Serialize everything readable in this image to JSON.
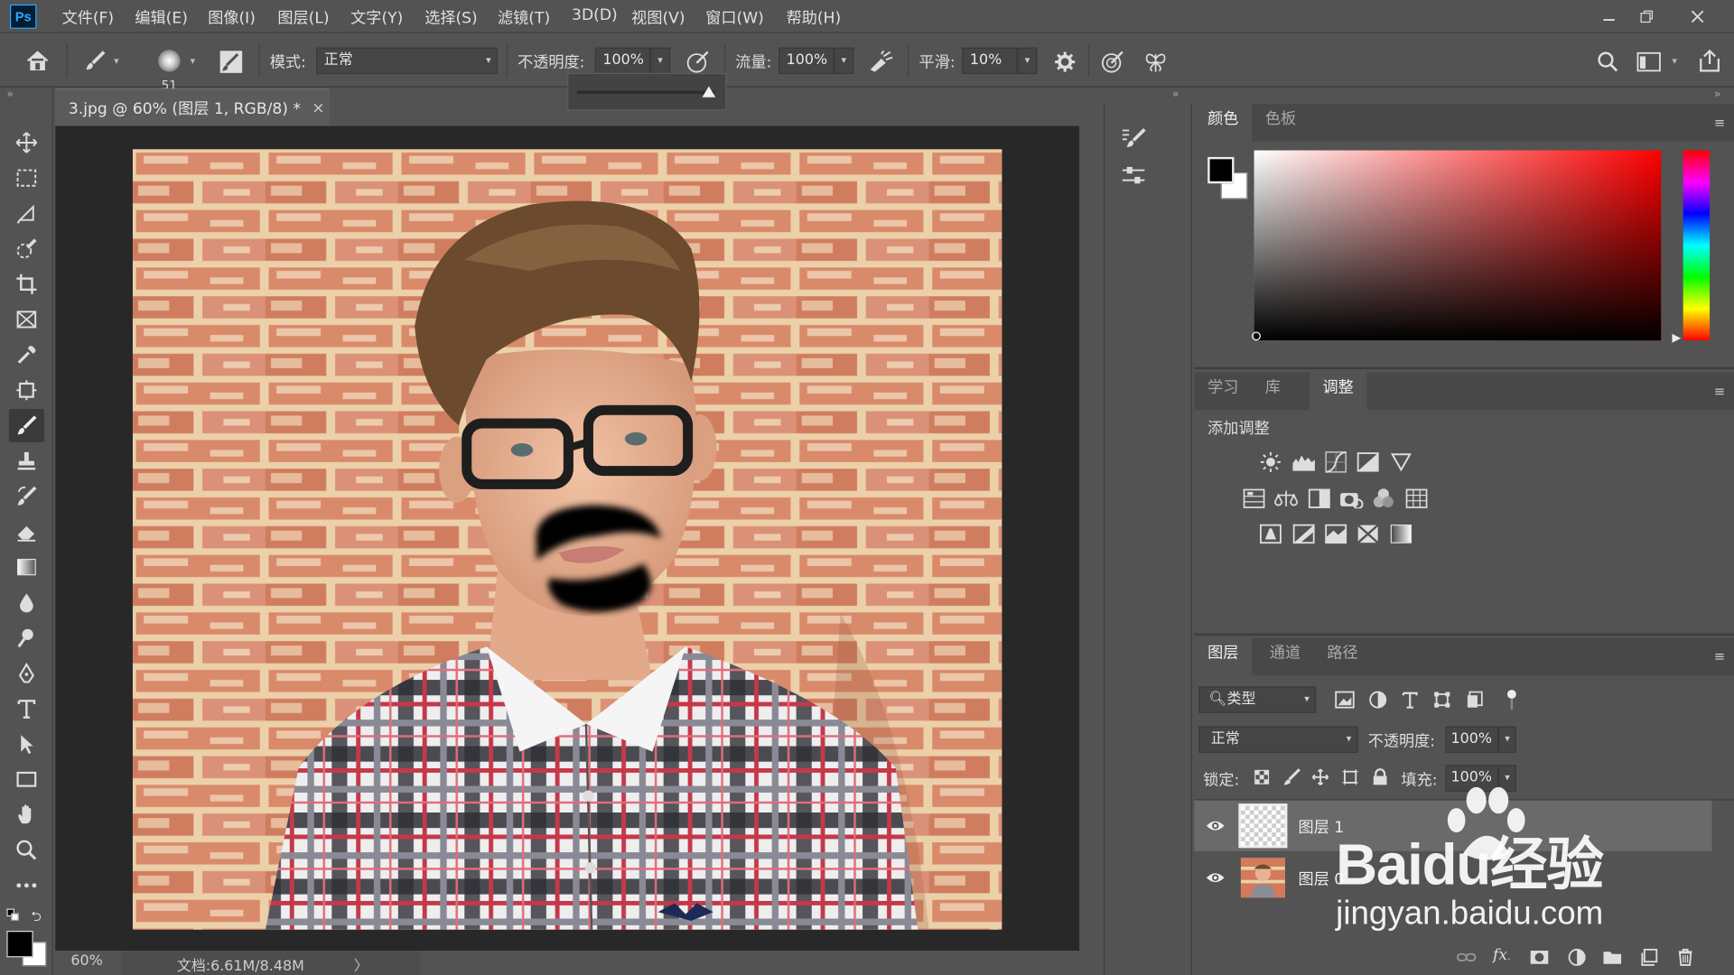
{
  "app": {
    "logo": "Ps"
  },
  "menu": [
    "文件(F)",
    "编辑(E)",
    "图像(I)",
    "图层(L)",
    "文字(Y)",
    "选择(S)",
    "滤镜(T)",
    "3D(D)",
    "视图(V)",
    "窗口(W)",
    "帮助(H)"
  ],
  "options": {
    "brush_size": "51",
    "mode_label": "模式:",
    "mode_value": "正常",
    "opacity_label": "不透明度:",
    "opacity_value": "100%",
    "flow_label": "流量:",
    "flow_value": "100%",
    "smoothing_label": "平滑:",
    "smoothing_value": "10%"
  },
  "document": {
    "tab_title": "3.jpg @ 60% (图层 1, RGB/8) *",
    "zoom": "60%",
    "doc_info": "文档:6.61M/8.48M"
  },
  "color_panel": {
    "tabs": [
      "颜色",
      "色板"
    ],
    "active": 0,
    "foreground": "#000000",
    "background": "#ffffff"
  },
  "adjust_panel": {
    "tabs": [
      "学习",
      "库",
      "调整"
    ],
    "active": 2,
    "title": "添加调整"
  },
  "layers_panel": {
    "tabs": [
      "图层",
      "通道",
      "路径"
    ],
    "active": 0,
    "filter_label": "类型",
    "blend_mode": "正常",
    "opacity_label": "不透明度:",
    "opacity_value": "100%",
    "lock_label": "锁定:",
    "fill_label": "填充:",
    "fill_value": "100%",
    "layers": [
      {
        "name": "图层 1",
        "selected": true,
        "visible": true
      },
      {
        "name": "图层 0",
        "selected": false,
        "visible": true
      }
    ]
  },
  "watermark": {
    "brand": "Baidu经验",
    "url": "jingyan.baidu.com"
  }
}
